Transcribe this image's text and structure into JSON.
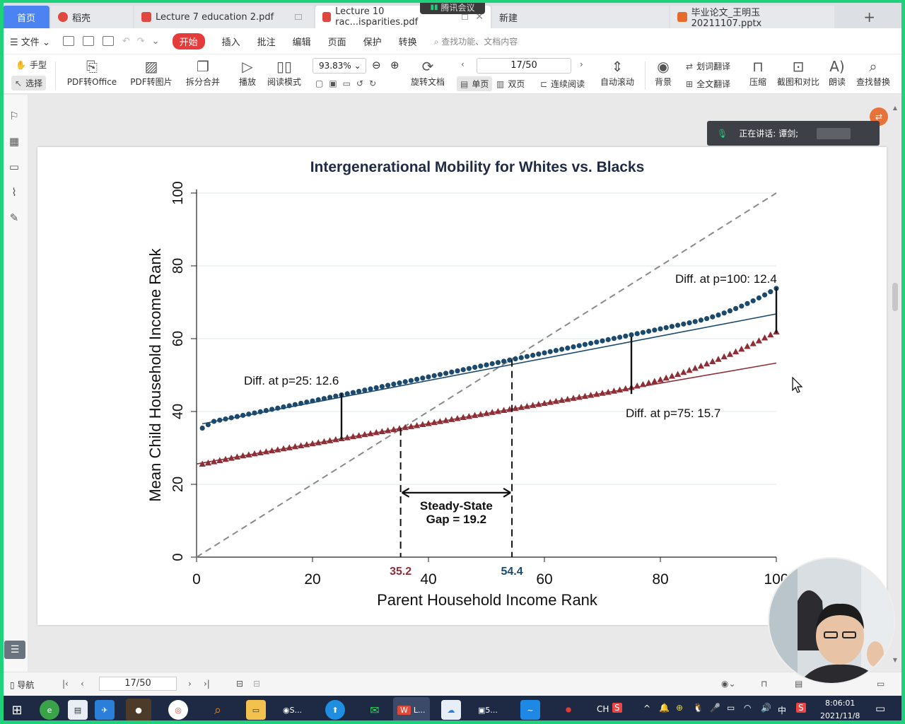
{
  "meeting": {
    "label": "腾讯会议"
  },
  "tabs": [
    {
      "label": "首页",
      "kind": "home"
    },
    {
      "label": "稻壳",
      "kind": "docer"
    },
    {
      "label": "Lecture 7 education 2.pdf",
      "kind": "pdf"
    },
    {
      "label": "Lecture 10 rac...isparities.pdf",
      "kind": "pdf",
      "active": true
    },
    {
      "label": "新建",
      "kind": "new"
    },
    {
      "label": "毕业论文_王明玉20211107.pptx",
      "kind": "ppt"
    }
  ],
  "menu": {
    "file": "文件",
    "start": "开始",
    "items": [
      "插入",
      "批注",
      "编辑",
      "页面",
      "保护",
      "转换"
    ],
    "search_placeholder": "查找功能、文档内容"
  },
  "toolbar": {
    "hand": "手型",
    "select": "选择",
    "pdf_to_office": "PDF转Office",
    "pdf_to_image": "PDF转图片",
    "split_merge": "拆分合并",
    "play": "播放",
    "read_mode": "阅读模式",
    "zoom": "93.83%",
    "rotate": "旋转文档",
    "page": "17/50",
    "single": "单页",
    "double": "双页",
    "continuous": "连续阅读",
    "auto_scroll": "自动滚动",
    "background": "背景",
    "word_translate": "划词翻译",
    "full_translate": "全文翻译",
    "compress": "压缩",
    "screenshot_compare": "截图和对比",
    "read_aloud": "朗读",
    "find_replace": "查找替换"
  },
  "speaking": {
    "label": "正在讲话: 谭剑;"
  },
  "orange_badge": "⇄",
  "status": {
    "nav": "导航",
    "page": "17/50"
  },
  "taskbar": {
    "app_labels": [
      "S...",
      "L...",
      "5..."
    ],
    "ime": "CH",
    "ime_mode": "中",
    "time": "8:06:01",
    "date": "2021/11/8"
  },
  "chart_data": {
    "type": "scatter",
    "title": "Intergenerational Mobility for Whites vs. Blacks",
    "xlabel": "Parent Household Income Rank",
    "ylabel": "Mean Child Household Income Rank",
    "xlim": [
      0,
      100
    ],
    "ylim": [
      0,
      100
    ],
    "xticks": [
      "0",
      "20",
      "40",
      "60",
      "80",
      "100"
    ],
    "yticks": [
      "0",
      "20",
      "40",
      "60",
      "80",
      "100"
    ],
    "series": [
      {
        "color": "#1c4a6e",
        "marker": "circle",
        "fit": {
          "intercept": 36.3,
          "slope": 0.33
        }
      },
      {
        "color": "#8e2f38",
        "marker": "triangle",
        "fit": {
          "intercept": 25.6,
          "slope": 0.277
        }
      }
    ],
    "annotations": {
      "p25": "Diff. at p=25: 12.6",
      "p75": "Diff. at p=75: 15.7",
      "p100": "Diff. at p=100: 12.4",
      "gap_line1": "Steady-State",
      "gap_line2": "Gap = 19.2",
      "ss_black": "35.2",
      "ss_white": "54.4"
    },
    "steady_state": {
      "black": 35.2,
      "white": 54.4
    },
    "diffs": [
      {
        "p": 25,
        "white": 45.0,
        "black": 32.4
      },
      {
        "p": 75,
        "white": 60.5,
        "black": 44.8
      },
      {
        "p": 100,
        "white": 74.0,
        "black": 61.6
      }
    ]
  }
}
